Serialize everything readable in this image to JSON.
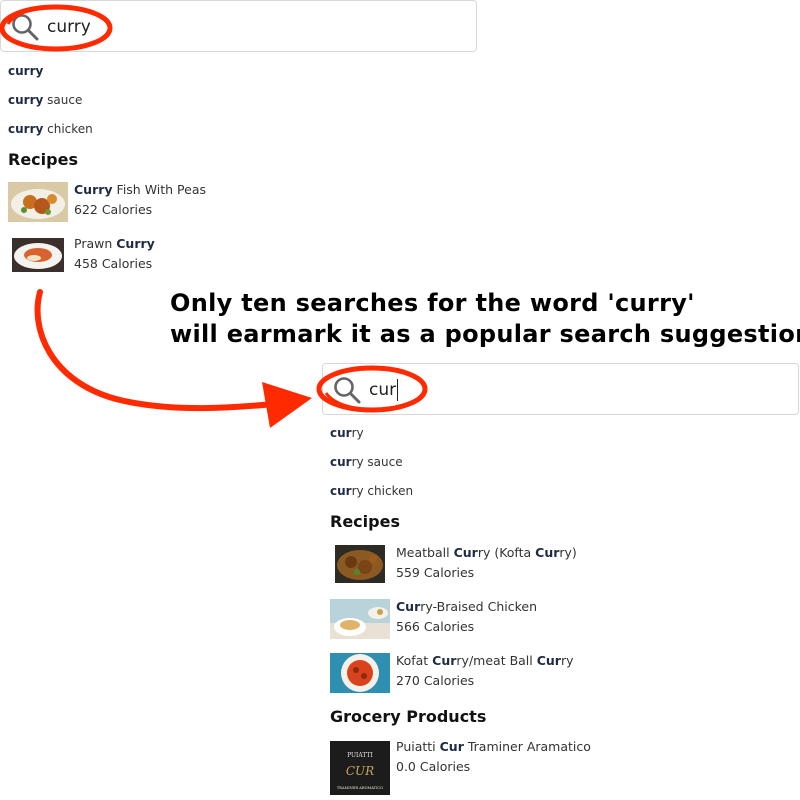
{
  "top_panel": {
    "search": {
      "query": "curry"
    },
    "suggestions": [
      {
        "bold": "curry",
        "rest": ""
      },
      {
        "bold": "curry",
        "rest": " sauce"
      },
      {
        "bold": "curry",
        "rest": " chicken"
      }
    ],
    "recipes_heading": "Recipes",
    "recipes": [
      {
        "name_bold": "Curry",
        "name_rest": " Fish With Peas",
        "calories": "622 Calories"
      },
      {
        "name_pre": "Prawn ",
        "name_bold": "Curry",
        "calories": "458 Calories"
      }
    ]
  },
  "annotation": {
    "line1": "Only ten searches for the word 'curry'",
    "line2": "will earmark it as a popular search suggestion"
  },
  "bottom_panel": {
    "search": {
      "query": "cur"
    },
    "suggestions": [
      {
        "bold": "cur",
        "rest": "ry"
      },
      {
        "bold": "cur",
        "rest": "ry sauce"
      },
      {
        "bold": "cur",
        "rest": "ry chicken"
      }
    ],
    "recipes_heading": "Recipes",
    "recipes": [
      {
        "p1": "Meatball ",
        "b1": "Cur",
        "p2": "ry (Kofta ",
        "b2": "Cur",
        "p3": "ry)",
        "calories": "559 Calories"
      },
      {
        "b1": "Cur",
        "p1": "ry-Braised Chicken",
        "calories": "566 Calories"
      },
      {
        "p1": "Kofat ",
        "b1": "Cur",
        "p2": "ry/meat Ball ",
        "b2": "Cur",
        "p3": "ry",
        "calories": "270 Calories"
      }
    ],
    "grocery_heading": "Grocery Products",
    "grocery": [
      {
        "p1": "Puiatti ",
        "b1": "Cur",
        "p2": " Traminer Aramatico",
        "calories": "0.0 Calories",
        "logo_text": "PUIATTI",
        "logo_mark": "CUR",
        "logo_sub": "TRAMINER AROMATICO"
      }
    ]
  },
  "colors": {
    "highlight_red": "#ff2a00",
    "bold_text": "#1f2a44"
  },
  "icons": [
    "search-icon",
    "curved-arrow-icon"
  ]
}
